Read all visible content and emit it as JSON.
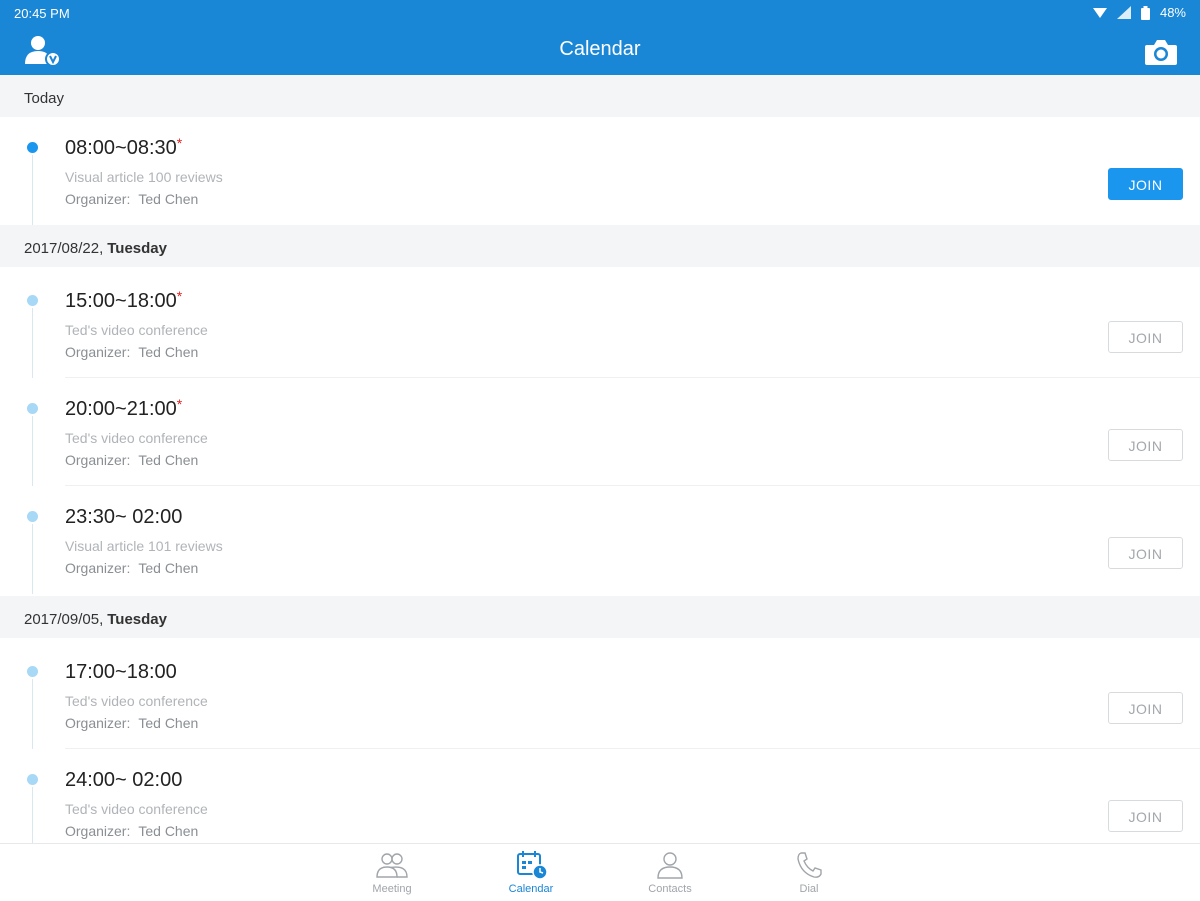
{
  "status_bar": {
    "time": "20:45 PM",
    "battery": "48%"
  },
  "app_bar": {
    "title": "Calendar"
  },
  "sections": [
    {
      "date": "Today",
      "dow": ""
    },
    {
      "date": "2017/08/22,",
      "dow": "Tuesday"
    },
    {
      "date": "2017/09/05,",
      "dow": "Tuesday"
    }
  ],
  "meetings": [
    {
      "time": "08:00~08:30",
      "star": "*",
      "subject": "Visual article 100 reviews",
      "organizer_label": "Organizer:",
      "organizer": "Ted Chen",
      "join_label": "JOIN"
    },
    {
      "time": "15:00~18:00",
      "star": "*",
      "subject": "Ted's video conference",
      "organizer_label": "Organizer:",
      "organizer": "Ted Chen",
      "join_label": "JOIN"
    },
    {
      "time": "20:00~21:00",
      "star": "*",
      "subject": "Ted's video conference",
      "organizer_label": "Organizer:",
      "organizer": "Ted Chen",
      "join_label": "JOIN"
    },
    {
      "time": "23:30~ 02:00",
      "star": "",
      "subject": "Visual article 101 reviews",
      "organizer_label": "Organizer:",
      "organizer": "Ted Chen",
      "join_label": "JOIN"
    },
    {
      "time": "17:00~18:00",
      "star": "",
      "subject": "Ted's video conference",
      "organizer_label": "Organizer:",
      "organizer": "Ted Chen",
      "join_label": "JOIN"
    },
    {
      "time": "24:00~ 02:00",
      "star": "",
      "subject": "Ted's video conference",
      "organizer_label": "Organizer:",
      "organizer": "Ted Chen",
      "join_label": "JOIN"
    }
  ],
  "bottom_nav": [
    {
      "label": "Meeting",
      "icon": "people-icon",
      "active": false
    },
    {
      "label": "Calendar",
      "icon": "calendar-clock-icon",
      "active": true
    },
    {
      "label": "Contacts",
      "icon": "person-icon",
      "active": false
    },
    {
      "label": "Dial",
      "icon": "phone-icon",
      "active": false
    }
  ],
  "colors": {
    "primary": "#1a86d6",
    "accent": "#1a96ef",
    "star": "#e02020"
  }
}
